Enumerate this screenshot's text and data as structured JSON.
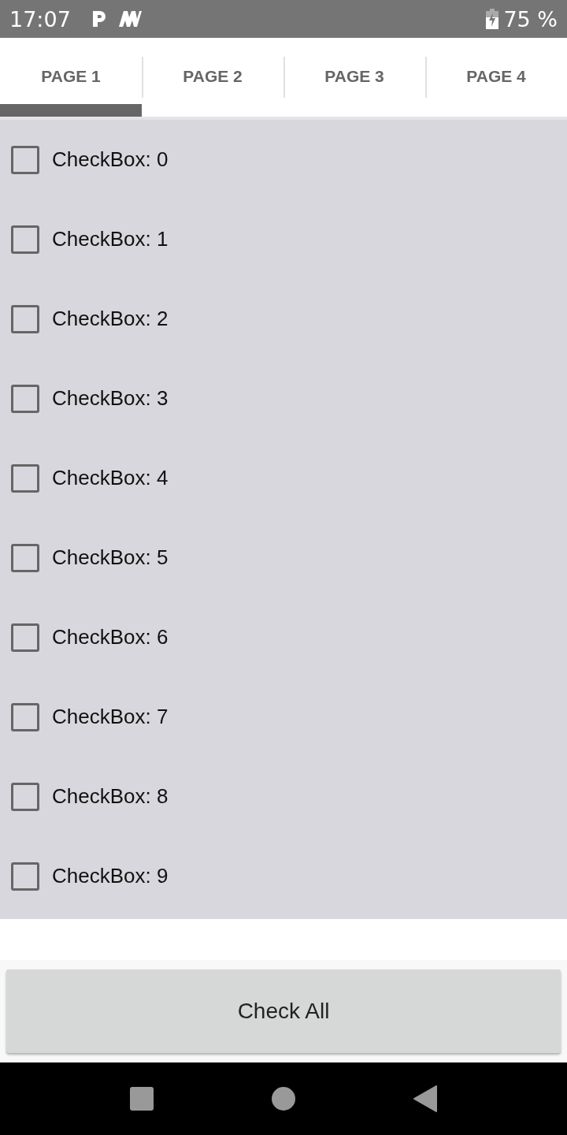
{
  "status_bar": {
    "time": "17:07",
    "battery": "75 %"
  },
  "tabs": [
    {
      "label": "PAGE 1",
      "selected": true
    },
    {
      "label": "PAGE 2",
      "selected": false
    },
    {
      "label": "PAGE 3",
      "selected": false
    },
    {
      "label": "PAGE 4",
      "selected": false
    }
  ],
  "checkboxes": [
    {
      "label": "CheckBox: 0",
      "checked": false
    },
    {
      "label": "CheckBox: 1",
      "checked": false
    },
    {
      "label": "CheckBox: 2",
      "checked": false
    },
    {
      "label": "CheckBox: 3",
      "checked": false
    },
    {
      "label": "CheckBox: 4",
      "checked": false
    },
    {
      "label": "CheckBox: 5",
      "checked": false
    },
    {
      "label": "CheckBox: 6",
      "checked": false
    },
    {
      "label": "CheckBox: 7",
      "checked": false
    },
    {
      "label": "CheckBox: 8",
      "checked": false
    },
    {
      "label": "CheckBox: 9",
      "checked": false
    }
  ],
  "button": "Check All"
}
